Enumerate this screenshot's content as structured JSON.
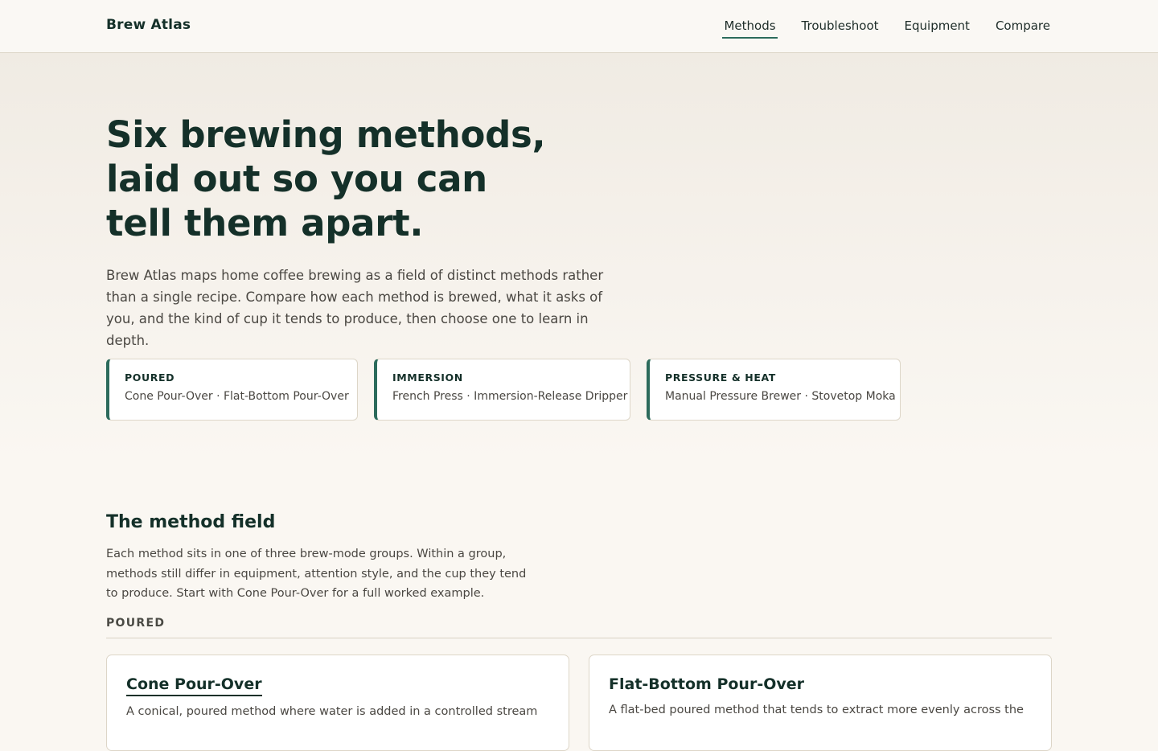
{
  "header": {
    "brand": "Brew Atlas",
    "nav": [
      "Methods",
      "Troubleshoot",
      "Equipment",
      "Compare"
    ],
    "active_nav": "Methods"
  },
  "hero": {
    "title_lines": [
      "Six brewing methods,",
      "laid out so you can",
      "tell them apart."
    ],
    "lede": "Brew Atlas maps home coffee brewing as a field of distinct methods rather than a single recipe. Compare how each method is brewed, what it asks of you, and the kind of cup it tends to produce, then choose one to learn in depth.",
    "groups": [
      {
        "name": "POURED",
        "methods": "Cone Pour-Over · Flat-Bottom Pour-Over"
      },
      {
        "name": "IMMERSION",
        "methods": "French Press · Immersion-Release Dripper"
      },
      {
        "name": "PRESSURE & HEAT",
        "methods": "Manual Pressure Brewer · Stovetop Moka"
      }
    ]
  },
  "method_field": {
    "title": "The method field",
    "description": "Each method sits in one of three brew-mode groups. Within a group, methods still differ in equipment, attention style, and the cup they tend to produce. Start with Cone Pour-Over for a full worked example.",
    "group_label": "POURED",
    "cards": [
      {
        "title": "Cone Pour-Over",
        "description": "A conical, poured method where water is added in a controlled stream"
      },
      {
        "title": "Flat-Bottom Pour-Over",
        "description": "A flat-bed poured method that tends to extract more evenly across the"
      }
    ]
  },
  "colors": {
    "accent": "#2c6b5c",
    "ink": "#143029",
    "background": "#faf7f2"
  }
}
